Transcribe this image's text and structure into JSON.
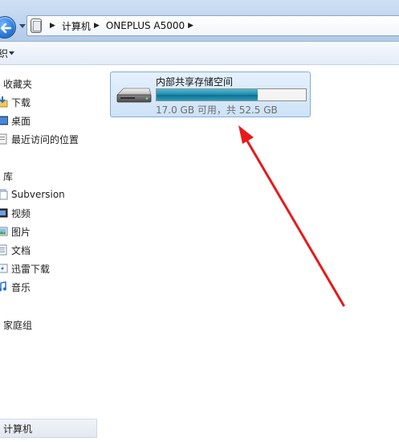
{
  "address_bar": {
    "crumbs": [
      "计算机",
      "ONEPLUS A5000"
    ]
  },
  "toolbar": {
    "organize_label": "织"
  },
  "nav": {
    "favorites_header": "收藏夹",
    "favorites": [
      {
        "label": "下载",
        "icon": "download-folder-icon"
      },
      {
        "label": "桌面",
        "icon": "desktop-icon"
      },
      {
        "label": "最近访问的位置",
        "icon": "recent-places-icon"
      }
    ],
    "libraries_header": "库",
    "libraries": [
      {
        "label": "Subversion",
        "icon": "subversion-library-icon"
      },
      {
        "label": "视频",
        "icon": "videos-library-icon"
      },
      {
        "label": "图片",
        "icon": "pictures-library-icon"
      },
      {
        "label": "文档",
        "icon": "documents-library-icon"
      },
      {
        "label": "迅雷下载",
        "icon": "thunder-download-icon"
      },
      {
        "label": "音乐",
        "icon": "music-library-icon"
      }
    ],
    "homegroup_header": "家庭组",
    "computer_label": "计算机"
  },
  "content": {
    "drive": {
      "name": "内部共享存储空间",
      "space_text": "17.0 GB 可用，共 52.5 GB",
      "used_fraction": 0.676,
      "icon": "storage-drive-icon"
    }
  },
  "colors": {
    "annotation_arrow": "#e8191b",
    "bar_fill": "#1f8fb0",
    "tile_border": "#84acd9"
  }
}
